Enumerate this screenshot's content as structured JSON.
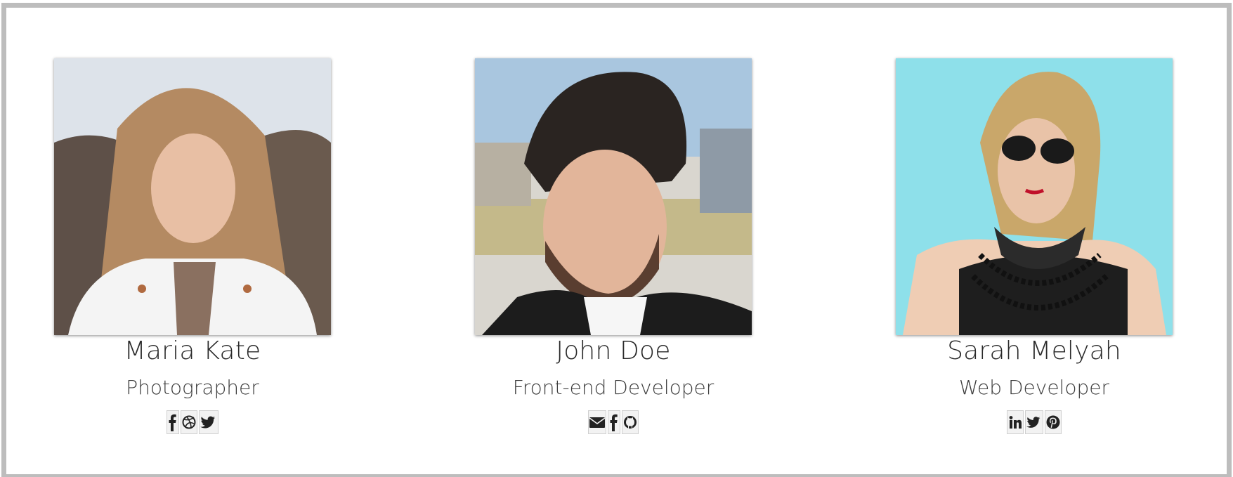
{
  "team": [
    {
      "name": "Maria Kate",
      "role": "Photographer",
      "socials": [
        "facebook-icon",
        "dribbble-icon",
        "twitter-icon"
      ]
    },
    {
      "name": "John Doe",
      "role": "Front-end Developer",
      "socials": [
        "envelope-icon",
        "facebook-icon",
        "github-icon"
      ]
    },
    {
      "name": "Sarah Melyah",
      "role": "Web Developer",
      "socials": [
        "linkedin-icon",
        "twitter-icon",
        "pinterest-icon"
      ]
    }
  ],
  "colors": {
    "frame_border": "#bdbdbd",
    "text": "#2a2a2a",
    "icon": "#222222",
    "photo3_background": "#8ee0ea"
  }
}
